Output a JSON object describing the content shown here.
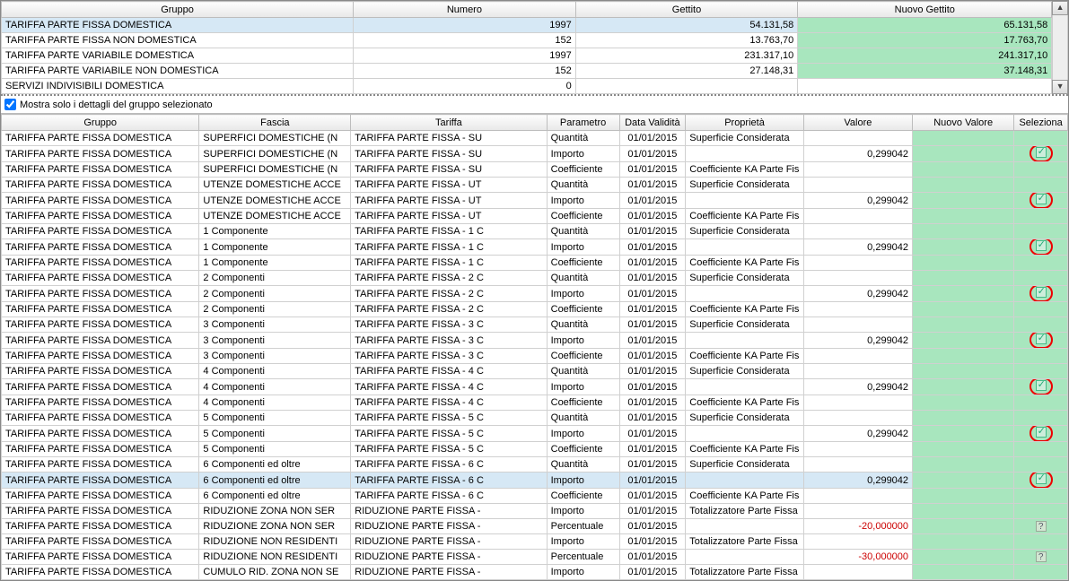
{
  "top": {
    "headers": [
      "Gruppo",
      "Numero",
      "Gettito",
      "Nuovo Gettito"
    ],
    "rows": [
      {
        "g": "TARIFFA PARTE FISSA DOMESTICA",
        "n": "1997",
        "ge": "54.131,58",
        "ng": "65.131,58",
        "sel": true
      },
      {
        "g": "TARIFFA PARTE FISSA NON DOMESTICA",
        "n": "152",
        "ge": "13.763,70",
        "ng": "17.763,70"
      },
      {
        "g": "TARIFFA PARTE VARIABILE DOMESTICA",
        "n": "1997",
        "ge": "231.317,10",
        "ng": "241.317,10"
      },
      {
        "g": "TARIFFA PARTE VARIABILE NON DOMESTICA",
        "n": "152",
        "ge": "27.148,31",
        "ng": "37.148,31"
      },
      {
        "g": "SERVIZI INDIVISIBILI DOMESTICA",
        "n": "0",
        "ge": "",
        "ng": "",
        "nogreen": true
      }
    ]
  },
  "filter": {
    "label": "Mostra solo i dettagli del gruppo selezionato",
    "checked": true
  },
  "det": {
    "headers": [
      "Gruppo",
      "Fascia",
      "Tariffa",
      "Parametro",
      "Data Validità",
      "Proprietà",
      "Valore",
      "Nuovo Valore",
      "Seleziona"
    ],
    "rows": [
      {
        "g": "TARIFFA PARTE FISSA DOMESTICA",
        "f": "SUPERFICI DOMESTICHE (N",
        "t": "TARIFFA PARTE FISSA - SU",
        "p": "Quantità",
        "d": "01/01/2015",
        "pr": "Superficie Considerata",
        "v": "",
        "nv": "",
        "chk": "green"
      },
      {
        "g": "TARIFFA PARTE FISSA DOMESTICA",
        "f": "SUPERFICI DOMESTICHE (N",
        "t": "TARIFFA PARTE FISSA - SU",
        "p": "Importo",
        "d": "01/01/2015",
        "pr": "",
        "v": "0,299042",
        "nv": "",
        "chk": "checked",
        "circle": true
      },
      {
        "g": "TARIFFA PARTE FISSA DOMESTICA",
        "f": "SUPERFICI DOMESTICHE (N",
        "t": "TARIFFA PARTE FISSA - SU",
        "p": "Coefficiente",
        "d": "01/01/2015",
        "pr": "Coefficiente KA Parte Fis",
        "v": "",
        "nv": "",
        "chk": "green"
      },
      {
        "g": "TARIFFA PARTE FISSA DOMESTICA",
        "f": "UTENZE DOMESTICHE ACCE",
        "t": "TARIFFA PARTE FISSA - UT",
        "p": "Quantità",
        "d": "01/01/2015",
        "pr": "Superficie Considerata",
        "v": "",
        "nv": "",
        "chk": "green"
      },
      {
        "g": "TARIFFA PARTE FISSA DOMESTICA",
        "f": "UTENZE DOMESTICHE ACCE",
        "t": "TARIFFA PARTE FISSA - UT",
        "p": "Importo",
        "d": "01/01/2015",
        "pr": "",
        "v": "0,299042",
        "nv": "",
        "chk": "checked",
        "circle": true
      },
      {
        "g": "TARIFFA PARTE FISSA DOMESTICA",
        "f": "UTENZE DOMESTICHE ACCE",
        "t": "TARIFFA PARTE FISSA - UT",
        "p": "Coefficiente",
        "d": "01/01/2015",
        "pr": "Coefficiente KA Parte Fis",
        "v": "",
        "nv": "",
        "chk": "green"
      },
      {
        "g": "TARIFFA PARTE FISSA DOMESTICA",
        "f": "1 Componente",
        "t": "TARIFFA PARTE FISSA - 1 C",
        "p": "Quantità",
        "d": "01/01/2015",
        "pr": "Superficie Considerata",
        "v": "",
        "nv": "",
        "chk": "green"
      },
      {
        "g": "TARIFFA PARTE FISSA DOMESTICA",
        "f": "1 Componente",
        "t": "TARIFFA PARTE FISSA - 1 C",
        "p": "Importo",
        "d": "01/01/2015",
        "pr": "",
        "v": "0,299042",
        "nv": "",
        "chk": "checked",
        "circle": true
      },
      {
        "g": "TARIFFA PARTE FISSA DOMESTICA",
        "f": "1 Componente",
        "t": "TARIFFA PARTE FISSA - 1 C",
        "p": "Coefficiente",
        "d": "01/01/2015",
        "pr": "Coefficiente KA Parte Fis",
        "v": "",
        "nv": "",
        "chk": "green"
      },
      {
        "g": "TARIFFA PARTE FISSA DOMESTICA",
        "f": "2 Componenti",
        "t": "TARIFFA PARTE FISSA - 2 C",
        "p": "Quantità",
        "d": "01/01/2015",
        "pr": "Superficie Considerata",
        "v": "",
        "nv": "",
        "chk": "green"
      },
      {
        "g": "TARIFFA PARTE FISSA DOMESTICA",
        "f": "2 Componenti",
        "t": "TARIFFA PARTE FISSA - 2 C",
        "p": "Importo",
        "d": "01/01/2015",
        "pr": "",
        "v": "0,299042",
        "nv": "",
        "chk": "checked",
        "circle": true
      },
      {
        "g": "TARIFFA PARTE FISSA DOMESTICA",
        "f": "2 Componenti",
        "t": "TARIFFA PARTE FISSA - 2 C",
        "p": "Coefficiente",
        "d": "01/01/2015",
        "pr": "Coefficiente KA Parte Fis",
        "v": "",
        "nv": "",
        "chk": "green"
      },
      {
        "g": "TARIFFA PARTE FISSA DOMESTICA",
        "f": "3 Componenti",
        "t": "TARIFFA PARTE FISSA - 3 C",
        "p": "Quantità",
        "d": "01/01/2015",
        "pr": "Superficie Considerata",
        "v": "",
        "nv": "",
        "chk": "green"
      },
      {
        "g": "TARIFFA PARTE FISSA DOMESTICA",
        "f": "3 Componenti",
        "t": "TARIFFA PARTE FISSA - 3 C",
        "p": "Importo",
        "d": "01/01/2015",
        "pr": "",
        "v": "0,299042",
        "nv": "",
        "chk": "checked",
        "circle": true
      },
      {
        "g": "TARIFFA PARTE FISSA DOMESTICA",
        "f": "3 Componenti",
        "t": "TARIFFA PARTE FISSA - 3 C",
        "p": "Coefficiente",
        "d": "01/01/2015",
        "pr": "Coefficiente KA Parte Fis",
        "v": "",
        "nv": "",
        "chk": "green"
      },
      {
        "g": "TARIFFA PARTE FISSA DOMESTICA",
        "f": "4 Componenti",
        "t": "TARIFFA PARTE FISSA - 4 C",
        "p": "Quantità",
        "d": "01/01/2015",
        "pr": "Superficie Considerata",
        "v": "",
        "nv": "",
        "chk": "green"
      },
      {
        "g": "TARIFFA PARTE FISSA DOMESTICA",
        "f": "4 Componenti",
        "t": "TARIFFA PARTE FISSA - 4 C",
        "p": "Importo",
        "d": "01/01/2015",
        "pr": "",
        "v": "0,299042",
        "nv": "",
        "chk": "checked",
        "circle": true
      },
      {
        "g": "TARIFFA PARTE FISSA DOMESTICA",
        "f": "4 Componenti",
        "t": "TARIFFA PARTE FISSA - 4 C",
        "p": "Coefficiente",
        "d": "01/01/2015",
        "pr": "Coefficiente KA Parte Fis",
        "v": "",
        "nv": "",
        "chk": "green"
      },
      {
        "g": "TARIFFA PARTE FISSA DOMESTICA",
        "f": "5 Componenti",
        "t": "TARIFFA PARTE FISSA - 5 C",
        "p": "Quantità",
        "d": "01/01/2015",
        "pr": "Superficie Considerata",
        "v": "",
        "nv": "",
        "chk": "green"
      },
      {
        "g": "TARIFFA PARTE FISSA DOMESTICA",
        "f": "5 Componenti",
        "t": "TARIFFA PARTE FISSA - 5 C",
        "p": "Importo",
        "d": "01/01/2015",
        "pr": "",
        "v": "0,299042",
        "nv": "",
        "chk": "checked",
        "circle": true
      },
      {
        "g": "TARIFFA PARTE FISSA DOMESTICA",
        "f": "5 Componenti",
        "t": "TARIFFA PARTE FISSA - 5 C",
        "p": "Coefficiente",
        "d": "01/01/2015",
        "pr": "Coefficiente KA Parte Fis",
        "v": "",
        "nv": "",
        "chk": "green"
      },
      {
        "g": "TARIFFA PARTE FISSA DOMESTICA",
        "f": "6 Componenti ed oltre",
        "t": "TARIFFA PARTE FISSA - 6 C",
        "p": "Quantità",
        "d": "01/01/2015",
        "pr": "Superficie Considerata",
        "v": "",
        "nv": "",
        "chk": "green"
      },
      {
        "g": "TARIFFA PARTE FISSA DOMESTICA",
        "f": "6 Componenti ed oltre",
        "t": "TARIFFA PARTE FISSA - 6 C",
        "p": "Importo",
        "d": "01/01/2015",
        "pr": "",
        "v": "0,299042",
        "nv": "",
        "chk": "checked",
        "circle": true,
        "rowsel": true
      },
      {
        "g": "TARIFFA PARTE FISSA DOMESTICA",
        "f": "6 Componenti ed oltre",
        "t": "TARIFFA PARTE FISSA - 6 C",
        "p": "Coefficiente",
        "d": "01/01/2015",
        "pr": "Coefficiente KA Parte Fis",
        "v": "",
        "nv": "",
        "chk": "green"
      },
      {
        "g": "TARIFFA PARTE FISSA DOMESTICA",
        "f": "RIDUZIONE ZONA NON SER",
        "t": "RIDUZIONE PARTE FISSA -",
        "p": "Importo",
        "d": "01/01/2015",
        "pr": "Totalizzatore Parte Fissa",
        "v": "",
        "nv": "",
        "chk": "green"
      },
      {
        "g": "TARIFFA PARTE FISSA DOMESTICA",
        "f": "RIDUZIONE ZONA NON SER",
        "t": "RIDUZIONE PARTE FISSA -",
        "p": "Percentuale",
        "d": "01/01/2015",
        "pr": "",
        "v": "-20,000000",
        "neg": true,
        "nv": "",
        "chk": "q"
      },
      {
        "g": "TARIFFA PARTE FISSA DOMESTICA",
        "f": "RIDUZIONE NON RESIDENTI",
        "t": "RIDUZIONE PARTE FISSA -",
        "p": "Importo",
        "d": "01/01/2015",
        "pr": "Totalizzatore Parte Fissa",
        "v": "",
        "nv": "",
        "chk": "green"
      },
      {
        "g": "TARIFFA PARTE FISSA DOMESTICA",
        "f": "RIDUZIONE NON RESIDENTI",
        "t": "RIDUZIONE PARTE FISSA -",
        "p": "Percentuale",
        "d": "01/01/2015",
        "pr": "",
        "v": "-30,000000",
        "neg": true,
        "nv": "",
        "chk": "q"
      },
      {
        "g": "TARIFFA PARTE FISSA DOMESTICA",
        "f": "CUMULO RID. ZONA NON SE",
        "t": "RIDUZIONE PARTE FISSA -",
        "p": "Importo",
        "d": "01/01/2015",
        "pr": "Totalizzatore Parte Fissa",
        "v": "",
        "nv": "",
        "chk": "green"
      }
    ]
  }
}
